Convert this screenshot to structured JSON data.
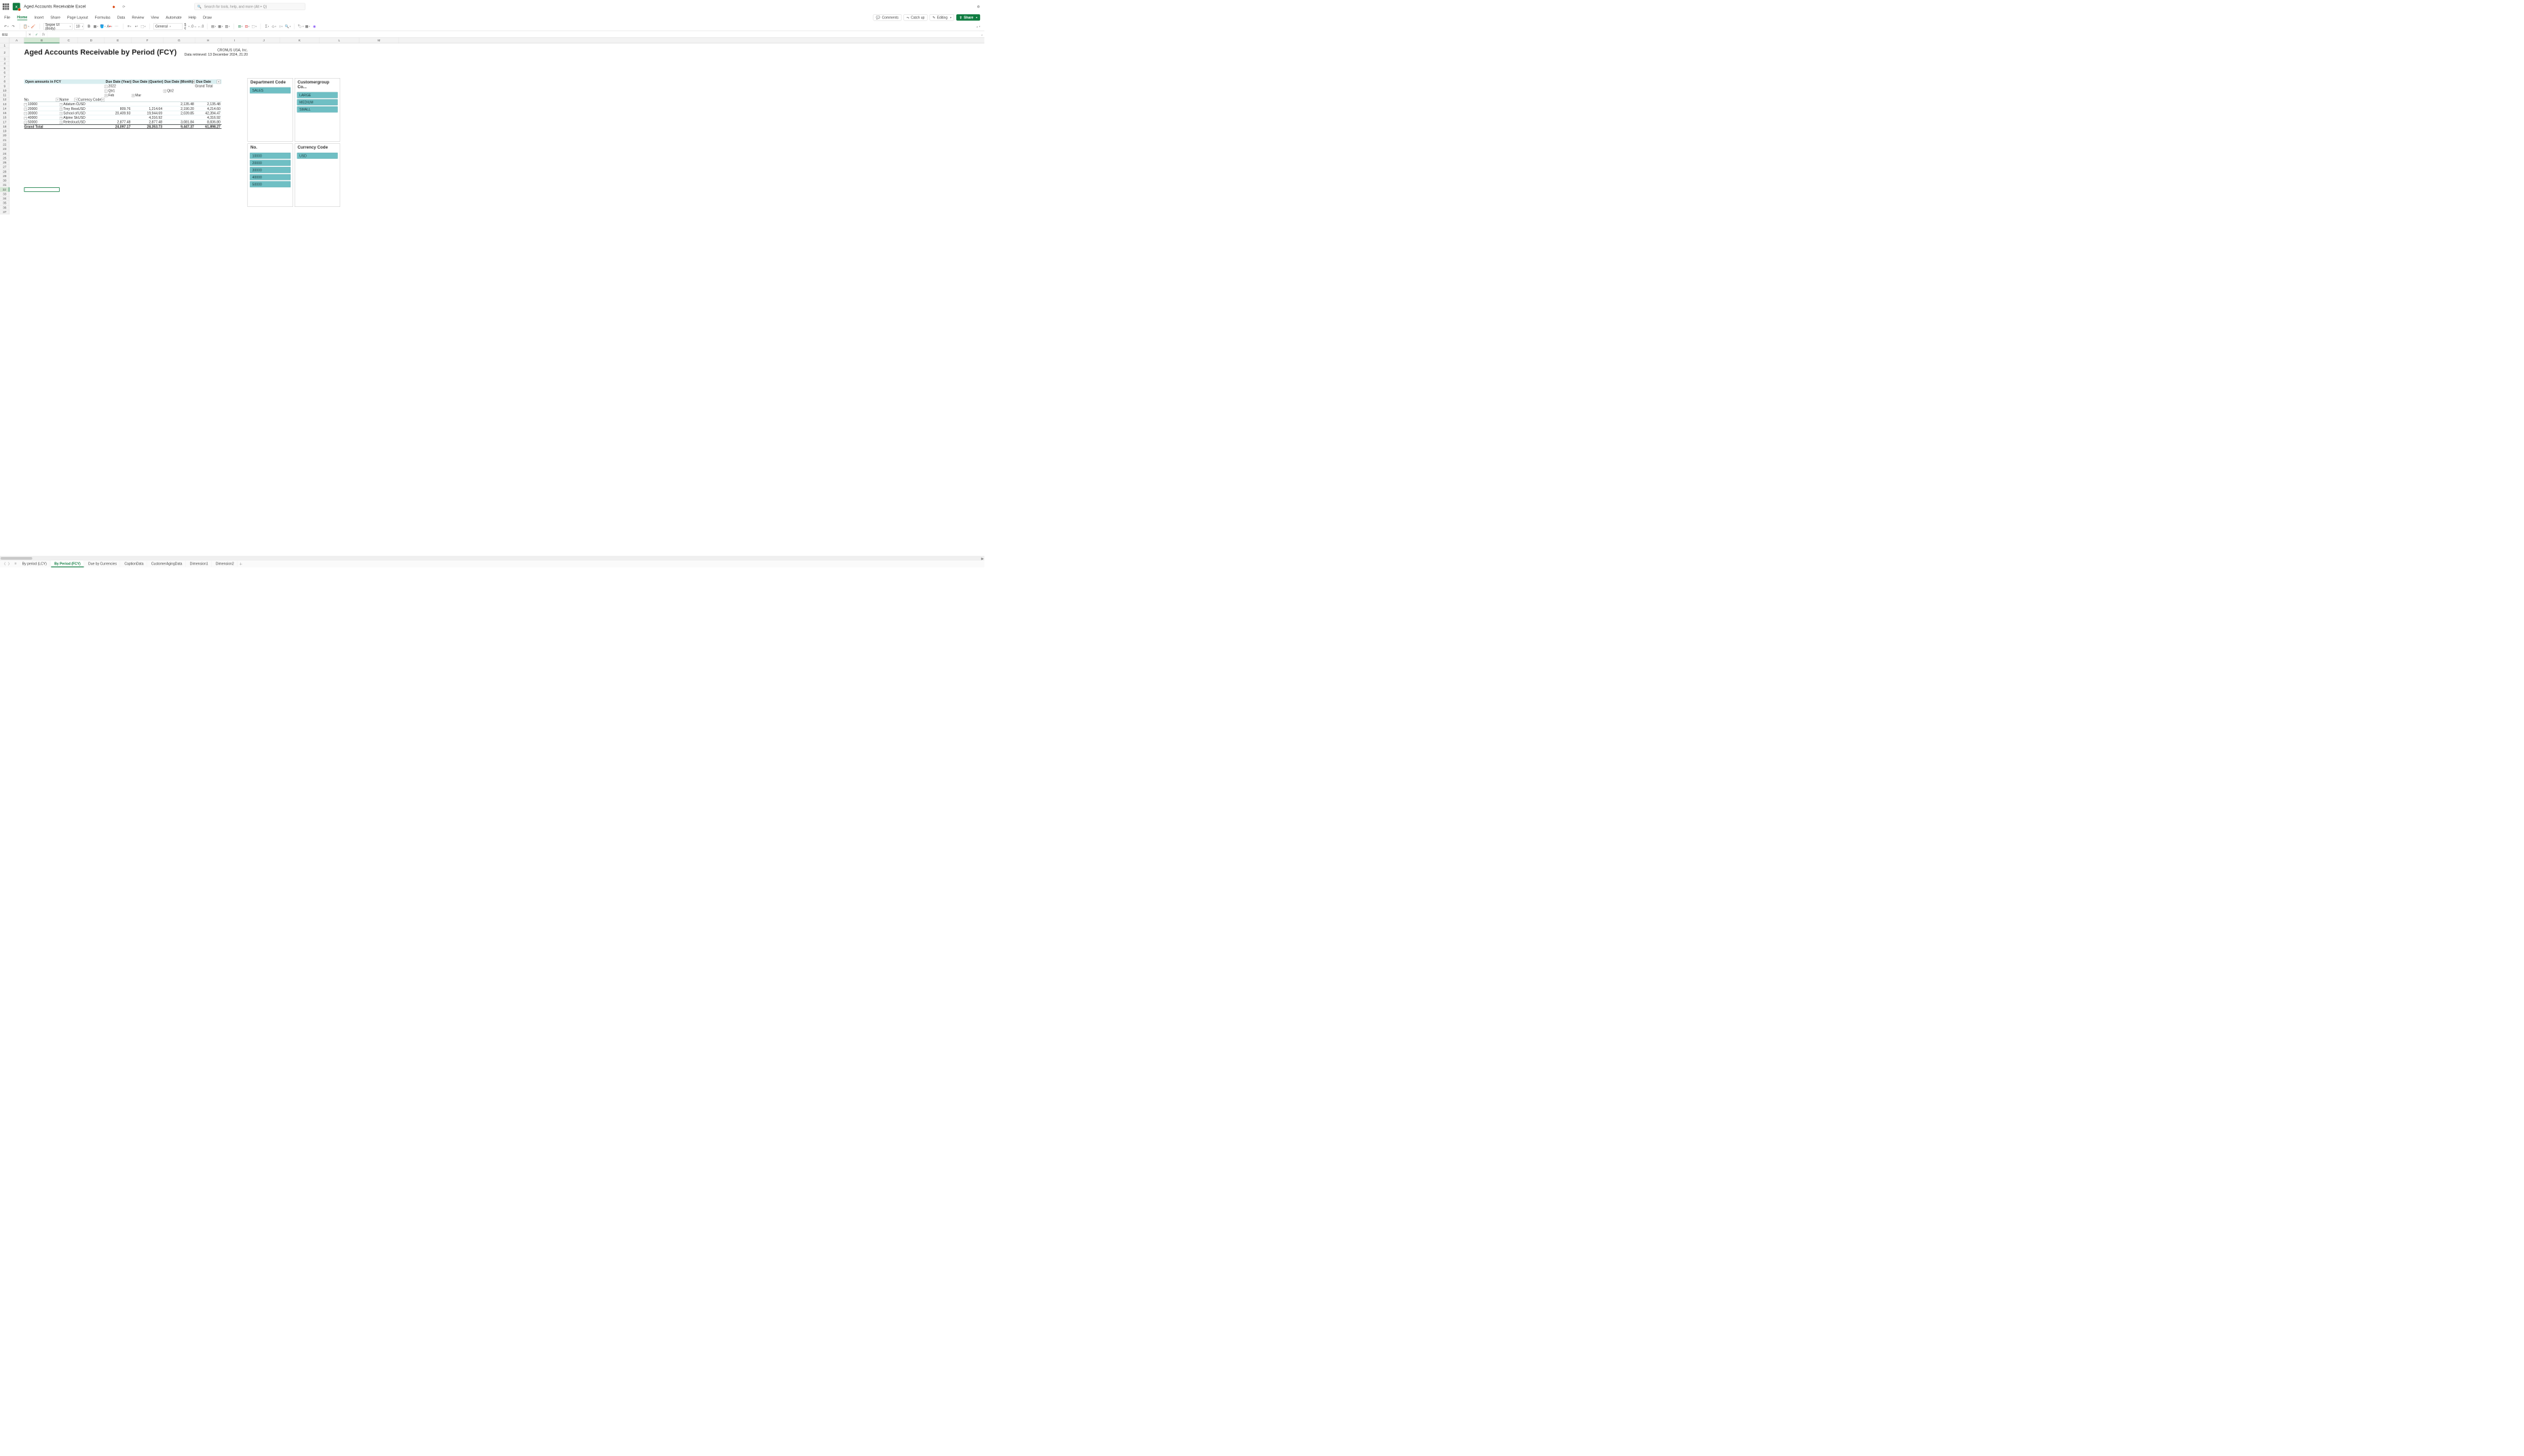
{
  "titlebar": {
    "doc_title": "Aged Accounts Receivable Excel",
    "search_placeholder": "Search for tools, help, and more (Alt + Q)"
  },
  "menubar": {
    "items": [
      "File",
      "Home",
      "Insert",
      "Share",
      "Page Layout",
      "Formulas",
      "Data",
      "Review",
      "View",
      "Automate",
      "Help",
      "Draw"
    ],
    "active_index": 1,
    "comments": "Comments",
    "catchup": "Catch up",
    "editing": "Editing",
    "share": "Share"
  },
  "ribbon": {
    "font_name": "Segoe UI (Body)",
    "font_size": "10",
    "number_format": "General"
  },
  "fxbar": {
    "name": "B32",
    "formula": ""
  },
  "columns": [
    "A",
    "B",
    "C",
    "D",
    "E",
    "F",
    "G",
    "H",
    "I",
    "J",
    "K",
    "L",
    "M"
  ],
  "row_count": 37,
  "report": {
    "title": "Aged Accounts Receivable by Period (FCY)",
    "company": "CRONUS USA, Inc.",
    "retrieved": "Data retrieved: 13 December 2024, 21:20",
    "open_amounts": "Open amounts in FCY",
    "col_year": "Due Date (Year)",
    "col_quarter": "Due Date (Quarter)",
    "col_month": "Due Date (Month)",
    "col_duedate": "Due Date",
    "year": "2022",
    "qtr1": "Qtr1",
    "qtr2": "Qtr2",
    "feb": "Feb",
    "mar": "Mar",
    "grand_total_col": "Grand Total",
    "row_labels": {
      "no": "No.",
      "name": "Name",
      "currency": "Currency Code"
    },
    "rows": [
      {
        "no": "10000",
        "name": "Adatum Co",
        "ccy": "USD",
        "feb": "",
        "mar": "",
        "qtr2": "2,135.48",
        "total": "2,135.48"
      },
      {
        "no": "20000",
        "name": "Trey Resear",
        "ccy": "USD",
        "feb": "809.76",
        "mar": "1,214.64",
        "qtr2": "2,190.20",
        "total": "4,214.60"
      },
      {
        "no": "30000",
        "name": "School of F",
        "ccy": "USD",
        "feb": "20,409.93",
        "mar": "19,944.69",
        "qtr2": "2,039.85",
        "total": "42,394.47"
      },
      {
        "no": "40000",
        "name": "Alpine Ski I",
        "ccy": "USD",
        "feb": "",
        "mar": "4,316.92",
        "qtr2": "",
        "total": "4,316.92"
      },
      {
        "no": "50000",
        "name": "Relecloud",
        "ccy": "USD",
        "feb": "2,877.48",
        "mar": "2,877.48",
        "qtr2": "3,081.84",
        "total": "8,836.80"
      }
    ],
    "grand_row": {
      "label": "Grand Total",
      "feb": "24,097.17",
      "mar": "28,353.73",
      "qtr2": "9,447.37",
      "total": "61,898.27"
    }
  },
  "slicers": {
    "dept": {
      "title": "Department Code",
      "items": [
        "SALES"
      ]
    },
    "custgrp": {
      "title": "Customergroup Co...",
      "items": [
        "LARGE",
        "MEDIUM",
        "SMALL"
      ]
    },
    "no": {
      "title": "No.",
      "items": [
        "10000",
        "20000",
        "30000",
        "40000",
        "50000"
      ]
    },
    "ccy": {
      "title": "Currency Code",
      "items": [
        "USD"
      ]
    }
  },
  "sheets": {
    "tabs": [
      "By period (LCY)",
      "By Period (FCY)",
      "Due by Currencies",
      "CaptionData",
      "CustomerAgingData",
      "Dimension1",
      "Dimension2"
    ],
    "active_index": 1
  }
}
